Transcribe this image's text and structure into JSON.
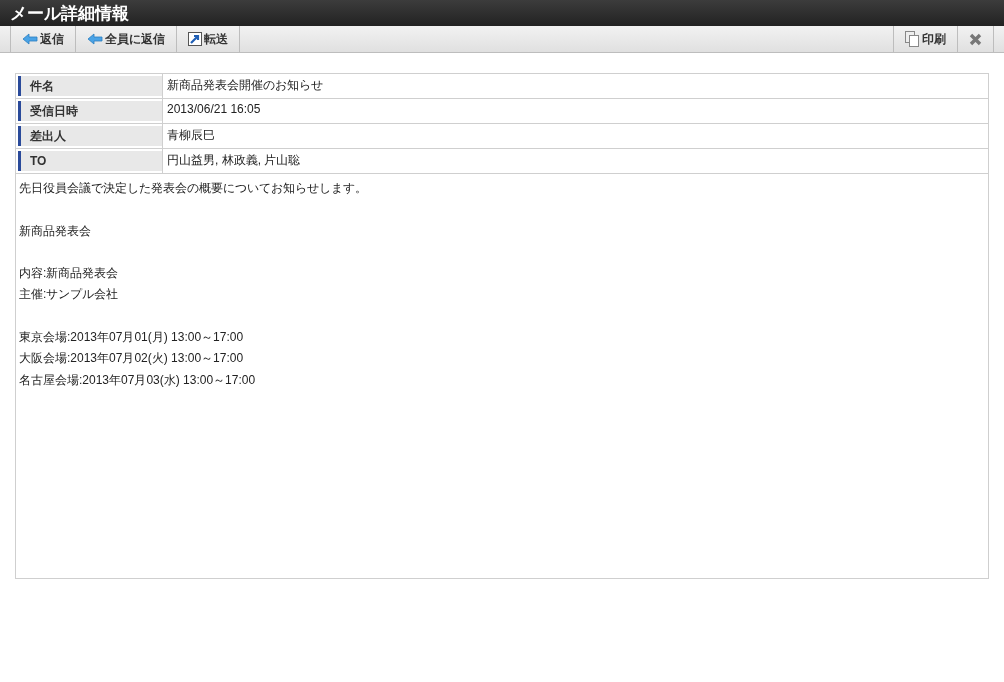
{
  "window": {
    "title": "メール詳細情報"
  },
  "toolbar": {
    "left": [
      {
        "kind": "reply",
        "label": "返信"
      },
      {
        "kind": "reply",
        "label": "全員に返信"
      },
      {
        "kind": "forward",
        "label": "転送"
      }
    ],
    "right": [
      {
        "kind": "print",
        "label": "印刷"
      },
      {
        "kind": "close"
      }
    ]
  },
  "fields": [
    {
      "label": "件名",
      "value": "新商品発表会開催のお知らせ"
    },
    {
      "label": "受信日時",
      "value": "2013/06/21 16:05"
    },
    {
      "label": "差出人",
      "value": "青柳辰巳"
    },
    {
      "label": "TO",
      "value": "円山益男, 林政義, 片山聡"
    }
  ],
  "body": [
    [
      "先日役員会議で決定した発表会の概要についてお知らせします。"
    ],
    [
      "新商品発表会"
    ],
    [
      "内容:新商品発表会",
      "主催:サンプル会社"
    ],
    [
      "東京会場:2013年07月01(月) 13:00～17:00",
      "大阪会場:2013年07月02(火) 13:00～17:00",
      "名古屋会場:2013年07月03(水) 13:00～17:00"
    ]
  ]
}
